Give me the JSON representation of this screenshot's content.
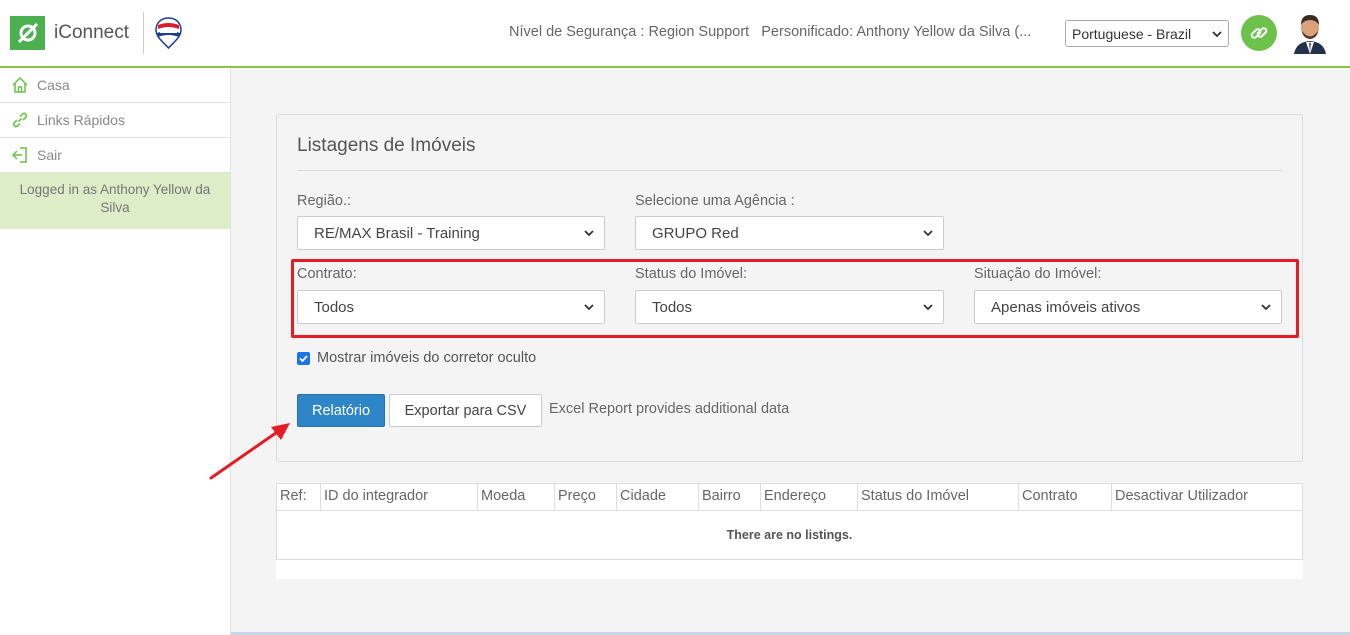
{
  "header": {
    "app_name": "iConnect",
    "security_level": "Nível de Segurança : Region Support",
    "impersonated": "Personificado: Anthony Yellow da Silva (...",
    "language_selected": "Portuguese - Brazil",
    "accent_color": "#6cc24a"
  },
  "sidebar": {
    "items": [
      {
        "label": "Casa",
        "icon": "home-icon"
      },
      {
        "label": "Links Rápidos",
        "icon": "link-icon"
      },
      {
        "label": "Sair",
        "icon": "sign-out-icon"
      }
    ],
    "logged_in": "Logged in as Anthony Yellow da Silva"
  },
  "panel": {
    "title": "Listagens de Imóveis",
    "regiao_label": "Região.:",
    "regiao_value": "RE/MAX Brasil - Training",
    "agencia_label": "Selecione uma Agência :",
    "agencia_value": "GRUPO Red",
    "contrato_label": "Contrato:",
    "contrato_value": "Todos",
    "status_label": "Status do Imóvel:",
    "status_value": "Todos",
    "situacao_label": "Situação do Imóvel:",
    "situacao_value": "Apenas imóveis ativos",
    "checkbox_label": "Mostrar imóveis do corretor oculto",
    "checkbox_checked": true,
    "report_button": "Relatório",
    "csv_button": "Exportar para CSV",
    "excel_note": "Excel Report provides additional data"
  },
  "table": {
    "columns": [
      "Ref:",
      "ID do integrador",
      "Moeda",
      "Preço",
      "Cidade",
      "Bairro",
      "Endereço",
      "Status do Imóvel",
      "Contrato",
      "Desactivar Utilizador"
    ],
    "empty_message": "There are no listings."
  }
}
